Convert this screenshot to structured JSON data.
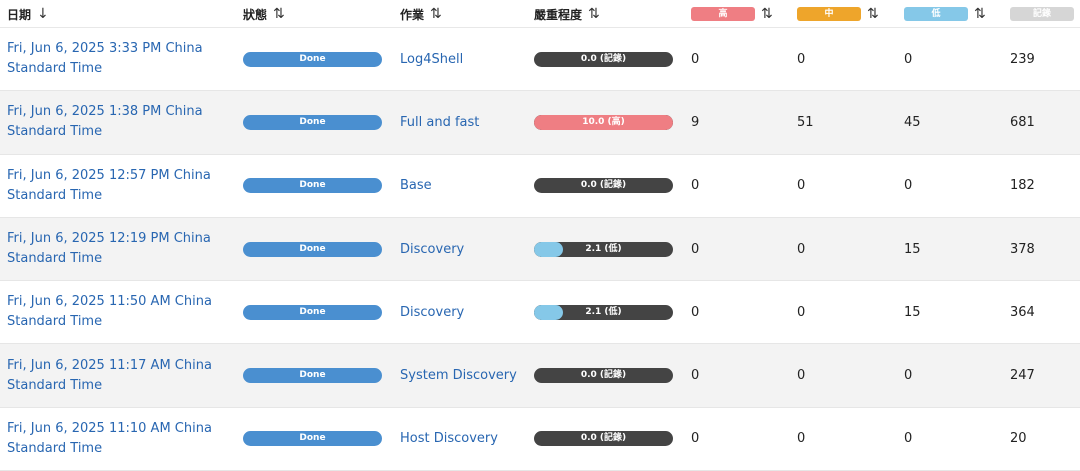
{
  "colors": {
    "high": "#ef7e83",
    "medium": "#eea52b",
    "low": "#85c8e8",
    "log": "#d6d6d6",
    "status_done": "#4a8fd0",
    "severity_bar_bg": "#444444",
    "link": "#2866b1"
  },
  "header": {
    "date": "日期",
    "status": "狀態",
    "task": "作業",
    "severity": "嚴重程度",
    "high": "高",
    "medium": "中",
    "low": "低",
    "log": "記錄",
    "sort_desc_icon": "↓",
    "sort_icon": "⇅"
  },
  "rows": [
    {
      "date": "Fri, Jun 6, 2025 3:33 PM China Standard Time",
      "status": "Done",
      "task": "Log4Shell",
      "severity_label": "0.0 (記錄)",
      "severity_value": 0.0,
      "severity_level": "log",
      "high": "0",
      "medium": "0",
      "low": "0",
      "log": "239"
    },
    {
      "date": "Fri, Jun 6, 2025 1:38 PM China Standard Time",
      "status": "Done",
      "task": "Full and fast",
      "severity_label": "10.0 (高)",
      "severity_value": 10.0,
      "severity_level": "high",
      "high": "9",
      "medium": "51",
      "low": "45",
      "log": "681"
    },
    {
      "date": "Fri, Jun 6, 2025 12:57 PM China Standard Time",
      "status": "Done",
      "task": "Base",
      "severity_label": "0.0 (記錄)",
      "severity_value": 0.0,
      "severity_level": "log",
      "high": "0",
      "medium": "0",
      "low": "0",
      "log": "182"
    },
    {
      "date": "Fri, Jun 6, 2025 12:19 PM China Standard Time",
      "status": "Done",
      "task": "Discovery",
      "severity_label": "2.1 (低)",
      "severity_value": 2.1,
      "severity_level": "low",
      "high": "0",
      "medium": "0",
      "low": "15",
      "log": "378"
    },
    {
      "date": "Fri, Jun 6, 2025 11:50 AM China Standard Time",
      "status": "Done",
      "task": "Discovery",
      "severity_label": "2.1 (低)",
      "severity_value": 2.1,
      "severity_level": "low",
      "high": "0",
      "medium": "0",
      "low": "15",
      "log": "364"
    },
    {
      "date": "Fri, Jun 6, 2025 11:17 AM China Standard Time",
      "status": "Done",
      "task": "System Discovery",
      "severity_label": "0.0 (記錄)",
      "severity_value": 0.0,
      "severity_level": "log",
      "high": "0",
      "medium": "0",
      "low": "0",
      "log": "247"
    },
    {
      "date": "Fri, Jun 6, 2025 11:10 AM China Standard Time",
      "status": "Done",
      "task": "Host Discovery",
      "severity_label": "0.0 (記錄)",
      "severity_value": 0.0,
      "severity_level": "log",
      "high": "0",
      "medium": "0",
      "low": "0",
      "log": "20"
    }
  ]
}
